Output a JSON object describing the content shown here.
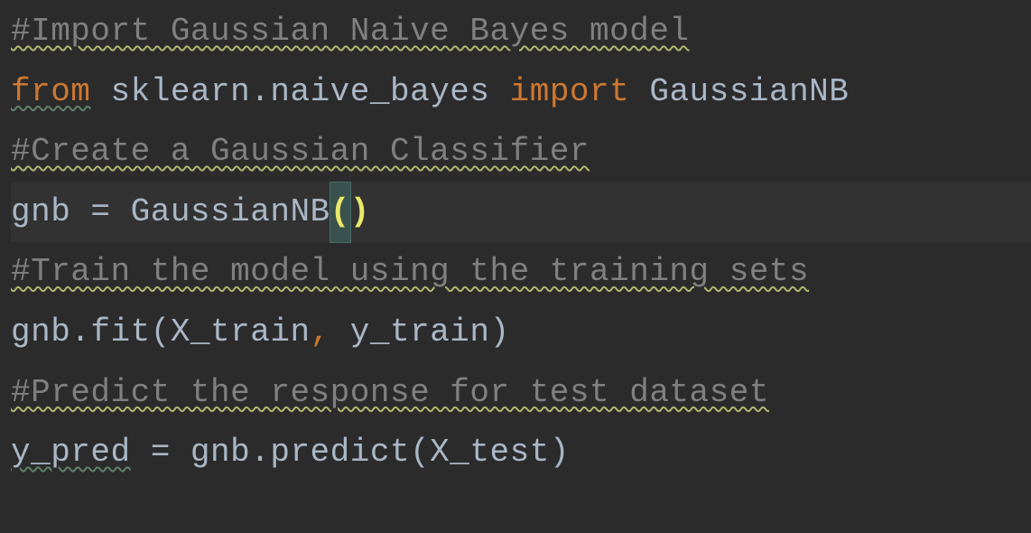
{
  "code": {
    "line1": {
      "comment": "#Import Gaussian Naive Bayes model"
    },
    "line2": {
      "kw_from": "from",
      "sp1": " ",
      "module": "sklearn.naive_bayes",
      "sp2": " ",
      "kw_import": "import",
      "sp3": " ",
      "cls": "GaussianNB"
    },
    "line3": {
      "comment": "#Create a Gaussian Classifier"
    },
    "line4": {
      "lhs": "gnb = GaussianNB",
      "lparen": "(",
      "rparen": ")"
    },
    "line5": {
      "comment": "#Train the model using the training sets"
    },
    "line6": {
      "pre": "gnb.fit(X_train",
      "comma": ",",
      "post": " y_train)"
    },
    "line7": {
      "comment": "#Predict the response for test dataset"
    },
    "line8": {
      "y": "y_pred",
      "rest": " = gnb.predict(X_test)"
    }
  }
}
